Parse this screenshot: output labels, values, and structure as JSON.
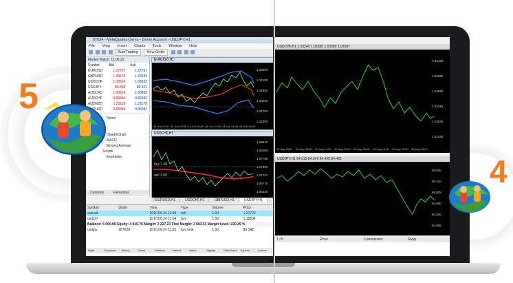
{
  "badges": {
    "mt5_number": "5",
    "mt4_number": "4",
    "accent_color": "#f47c20"
  },
  "mt5": {
    "title": "97634 - MetaQuotes-Demo - Demo Account - USDJPY,H1",
    "menu": [
      "File",
      "View",
      "Insert",
      "Charts",
      "Tools",
      "Window",
      "Help"
    ],
    "toolbar": {
      "autotrading": "AutoTrading",
      "new_order": "New Order"
    },
    "market_watch": {
      "title": "Market Watch: 11:06:22",
      "headers": [
        "Symbol",
        "Bid",
        "Ask"
      ],
      "rows": [
        {
          "symbol": "EURUSD",
          "bid": "1.22727",
          "ask": "1.22767"
        },
        {
          "symbol": "GBPUSD",
          "bid": "1.49673",
          "ask": "1.49699"
        },
        {
          "symbol": "USDCHF",
          "bid": "1.03514",
          "ask": "1.03532"
        },
        {
          "symbol": "USDJPY",
          "bid": "89.306",
          "ask": "89.321"
        },
        {
          "symbol": "AUDCAD",
          "bid": "1.00814",
          "ask": "1.00862"
        },
        {
          "symbol": "AUDCHF",
          "bid": "0.86844",
          "ask": "0.86883"
        },
        {
          "symbol": "AUDNZD",
          "bid": "1.23119",
          "ask": "1.23178"
        },
        {
          "symbol": "AUDUSD",
          "bid": "0.86064",
          "ask": "0.86081"
        }
      ]
    },
    "navigator": [
      "Demo",
      "ChartInChart",
      "MACD",
      "Moving Average",
      "Scripts",
      "Examples"
    ],
    "navigator_tabs": [
      "Common",
      "Favourites"
    ],
    "chart_windows": [
      {
        "title": "EURUSD,H1"
      },
      {
        "title": "USDCHF,H1"
      }
    ],
    "chart_tabs": [
      "EURUSD,H1",
      "USDCHF,H1",
      "GBPUSD,H1",
      "USDJPY,H1"
    ],
    "eur_axis": [
      "1.24500",
      "1.24100",
      "1.23600",
      "1.23200",
      "1.22700",
      "1.22300"
    ],
    "eur_time": [
      "24 Jun 2010",
      "24 Jun 00:00",
      "24 Jun 06:00",
      "24 Jun 10:00",
      "24 Jun 14:00",
      "24 Jun 18:00"
    ],
    "chf_axis": [
      "1.08510",
      "1.08100",
      "1.07790",
      "1.07460",
      "1.07110",
      "1.06770",
      "1.06420"
    ],
    "chf_levels": [
      "buy 1.00",
      "sell 1.00"
    ],
    "terminal": {
      "headers": [
        "Symbol",
        "Order",
        "Time",
        "Type",
        "Volume",
        "Price"
      ],
      "rows": [
        {
          "symbol": "eurusd",
          "order": "",
          "time": "2010.06.24 11:04",
          "type": "sell",
          "volume": "1.00",
          "price": "1.22723"
        },
        {
          "symbol": "usdchf",
          "order": "",
          "time": "2010.06.24 11:04",
          "type": "buy",
          "volume": "1.00",
          "price": "1.10504"
        }
      ],
      "balance": "Balance: 5 000.00  Equity: 4 910.76  Margin: 2 227.23  Free Margin: 2 683.53  Margin Level: 220.49 %",
      "pending": {
        "symbol": "usdjpy",
        "order": "957628",
        "time": "2010.06.24 11.65",
        "type": "buy limit",
        "volume": "1.00",
        "price": "89.342"
      },
      "bottom_tabs": [
        "Trade",
        "Exposure",
        "History",
        "News",
        "Mailbox",
        "Market",
        "Alerts",
        "Signals",
        "Code Base",
        "Experts",
        "Journal"
      ]
    }
  },
  "mt4": {
    "chart1": {
      "title": "USDCHF,H1  1.03240 1.03280 1.03080 1.03097",
      "axis": [
        "1.04420",
        "1.04025",
        "1.03625",
        "1.03215",
        "1.02830",
        "1.02430"
      ],
      "time": [
        "19 Aug 2010",
        "20 Aug 06:00",
        "20 Aug 14:00",
        "22 Aug 22:00",
        "23 Aug 06:00",
        "23 Aug 14:00",
        "23 Aug 22:00",
        "24 Aug 06:00"
      ]
    },
    "chart2": {
      "title": "USDJPY,H1  84.515 84.545 84.425 84.435",
      "axis": [
        "85.630",
        "85.310",
        "85.005",
        "84.690",
        "84.400",
        "84.095"
      ],
      "time": [
        "19 Aug 2010",
        "20 Aug 05:00",
        "20 Aug 13:00",
        "22 Aug 21:00",
        "23 Aug 05:00",
        "23 Aug 13:00",
        "23 Aug 21:00",
        "24 Aug 05:00"
      ]
    },
    "terminal_headers": [
      "T / P",
      "Price",
      "Commission",
      "Swap"
    ]
  }
}
